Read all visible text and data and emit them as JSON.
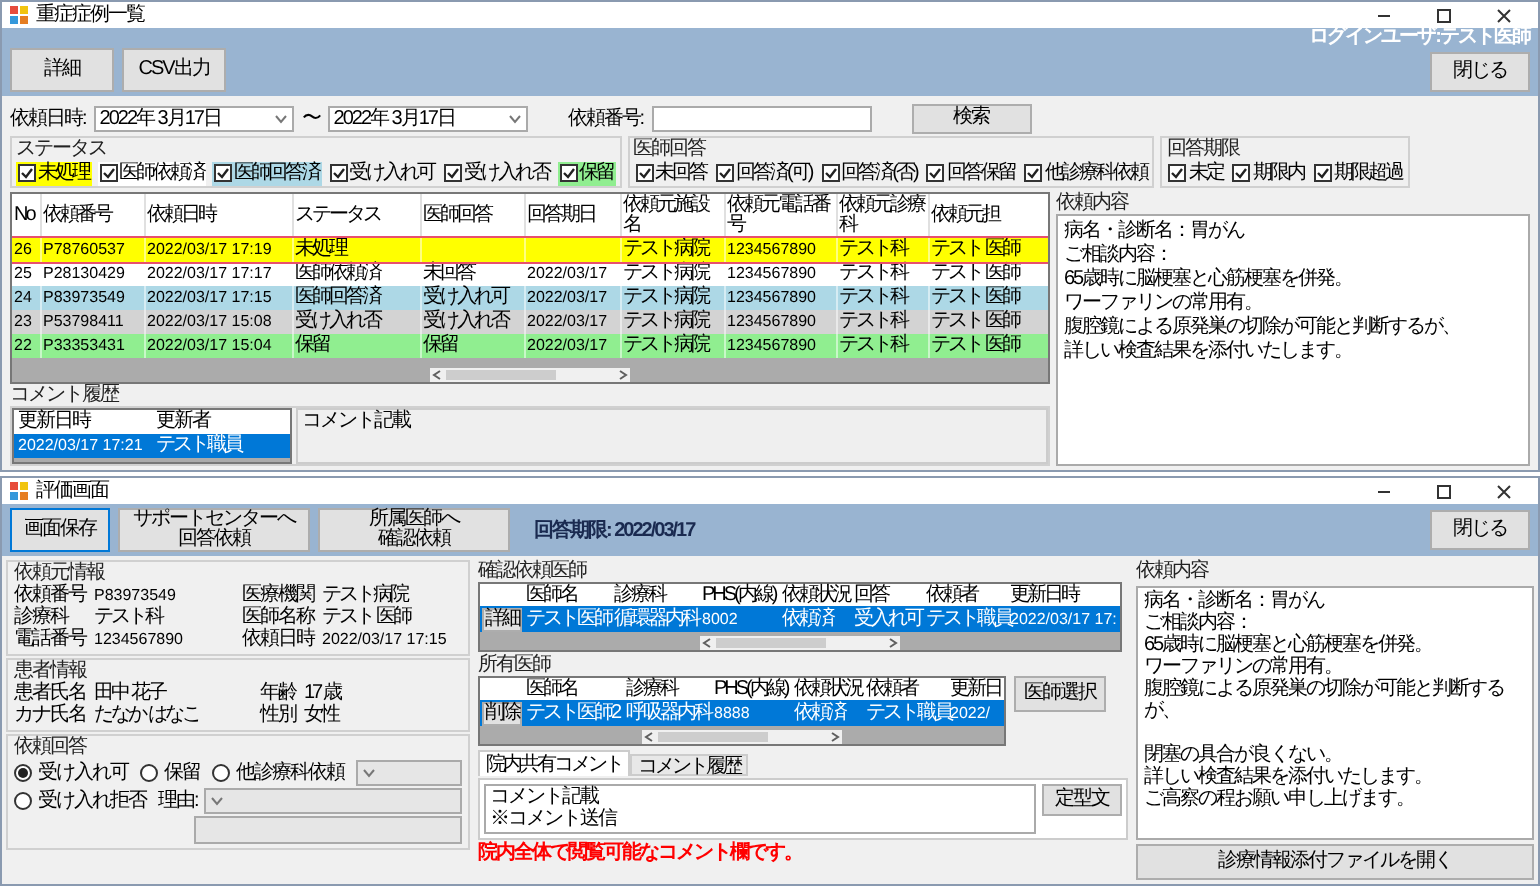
{
  "main_window": {
    "title": "重症症例一覧",
    "toolbar": {
      "buttons": [
        "詳細",
        "CSV出力"
      ],
      "login_user": "ログインユーザ:テスト医師",
      "close_button": "閉じる"
    },
    "filter": {
      "date_label": "依頼日時:",
      "date_from": "2022年 3月17日",
      "separator": "〜",
      "date_to": "2022年 3月17日",
      "number_label": "依頼番号:",
      "search_button": "検索"
    },
    "filter_groups": [
      {
        "title": "ステータス",
        "options": [
          {
            "label": "未処理",
            "checked": true,
            "color": "#ffff00"
          },
          {
            "label": "医師依頼済",
            "checked": true,
            "color": "#ffffff"
          },
          {
            "label": "医師回答済",
            "checked": true,
            "color": "#add8e6"
          },
          {
            "label": "受け入れ可",
            "checked": true
          },
          {
            "label": "受け入れ否",
            "checked": true
          },
          {
            "label": "保留",
            "checked": true,
            "color": "#90ee90"
          }
        ]
      },
      {
        "title": "医師回答",
        "options": [
          {
            "label": "未回答",
            "checked": true
          },
          {
            "label": "回答済(可)",
            "checked": true
          },
          {
            "label": "回答済(否)",
            "checked": true
          },
          {
            "label": "回答保留",
            "checked": true
          },
          {
            "label": "他診療科依頼",
            "checked": true
          }
        ]
      },
      {
        "title": "回答期限",
        "options": [
          {
            "label": "未定",
            "checked": true
          },
          {
            "label": "期限内",
            "checked": true
          },
          {
            "label": "期限超過",
            "checked": true
          }
        ]
      }
    ],
    "table": {
      "columns": [
        "No",
        "依頼番号",
        "依頼日時",
        "ステータス",
        "医師回答",
        "回答期日",
        "依頼元施設名",
        "依頼元電話番号",
        "依頼元診療科",
        "依頼元担"
      ],
      "rows": [
        {
          "cells": [
            "26",
            "P78760537",
            "2022/03/17 17:19",
            "未処理",
            null,
            null,
            "テスト病院",
            "1234567890",
            "テスト科",
            "テスト 医師"
          ],
          "color": "#ffff00",
          "selected": true
        },
        {
          "cells": [
            "25",
            "P28130429",
            "2022/03/17 17:17",
            "医師依頼済",
            "未回答",
            "2022/03/17",
            "テスト病院",
            "1234567890",
            "テスト科",
            "テスト 医師"
          ],
          "color": "#ffffff",
          "selected": false
        },
        {
          "cells": [
            "24",
            "P83973549",
            "2022/03/17 17:15",
            "医師回答済",
            "受け入れ可",
            "2022/03/17",
            "テスト病院",
            "1234567890",
            "テスト科",
            "テスト 医師"
          ],
          "color": "#add8e6",
          "selected": false
        },
        {
          "cells": [
            "23",
            "P53798411",
            "2022/03/17 15:08",
            "受け入れ否",
            "受け入れ否",
            "2022/03/17",
            "テスト病院",
            "1234567890",
            "テスト科",
            "テスト 医師"
          ],
          "color": "#d3d3d3",
          "selected": false
        },
        {
          "cells": [
            "22",
            "P33353431",
            "2022/03/17 15:04",
            "保留",
            "保留",
            "2022/03/17",
            "テスト病院",
            "1234567890",
            "テスト科",
            "テスト 医師"
          ],
          "color": "#90ee90",
          "selected": false
        }
      ]
    },
    "comment_history": {
      "title": "コメント履歴",
      "columns": [
        "更新日時",
        "更新者"
      ],
      "rows": [
        {
          "cells": [
            "2022/03/17 17:21",
            "テスト職員"
          ],
          "selected": true
        }
      ],
      "comment": "コメント記載"
    },
    "request_panel": {
      "title": "依頼内容",
      "lines": [
        "病名・診断名：胃がん",
        "ご相談内容：",
        "65歳時に脳梗塞と心筋梗塞を併発。",
        "ワーファリンの常用有。",
        "腹腔鏡による原発巣の切除が可能と判断するが、",
        "詳しい検査結果を添付いたします。"
      ]
    }
  },
  "detail_window": {
    "title": "評価画面",
    "toolbar": {
      "buttons": [
        [
          "画面保存"
        ],
        [
          "サポートセンターへ",
          "回答依頼"
        ],
        [
          "所属医師へ",
          "確認依頼"
        ]
      ],
      "deadline": "回答期限: 2022/03/17",
      "close_button": "閉じる"
    },
    "requester": {
      "title": "依頼元情報",
      "fields": [
        {
          "label": "依頼番号",
          "value": "P83973549"
        },
        {
          "label": "医療機関",
          "value": "テスト病院"
        },
        {
          "label": "診療科",
          "value": "テスト科"
        },
        {
          "label": "医師名称",
          "value": "テスト 医師"
        },
        {
          "label": "電話番号",
          "value": "1234567890"
        },
        {
          "label": "依頼日時",
          "value": "2022/03/17 17:15"
        }
      ]
    },
    "patient": {
      "title": "患者情報",
      "fields": [
        {
          "label": "患者氏名",
          "value": "田中 花子"
        },
        {
          "label": "年齢",
          "value": "17 歳"
        },
        {
          "label": "カナ氏名",
          "value": "たなか はなこ"
        },
        {
          "label": "性別",
          "value": "女性"
        }
      ]
    },
    "answer": {
      "title": "依頼回答",
      "options": [
        {
          "label": "受け入れ可",
          "selected": true
        },
        {
          "label": "保留",
          "selected": false
        },
        {
          "label": "他診療科依頼",
          "selected": false
        },
        {
          "label": "受け入れ拒否",
          "selected": false
        }
      ],
      "reason_label": "理由:"
    },
    "confirm_doctors": {
      "title": "確認依頼医師",
      "columns": [
        "医師名",
        "診療科",
        "PHS(内線)",
        "依頼状況",
        "回答",
        "依頼者",
        "更新日時"
      ],
      "rows": [
        {
          "button": "詳細",
          "cells": [
            "テスト医師",
            "循環器内科",
            "8002",
            "依頼済",
            "受入れ可",
            "テスト職員",
            "2022/03/17 17:"
          ],
          "selected": true
        }
      ]
    },
    "shared_doctors": {
      "title": "所有医師",
      "columns": [
        "医師名",
        "診療科",
        "PHS(内線)",
        "依頼状況",
        "依頼者",
        "更新日"
      ],
      "rows": [
        {
          "button": "削除",
          "cells": [
            "テスト医師2",
            "呼吸器内科",
            "8888",
            "依頼済",
            "テスト職員",
            "2022/"
          ],
          "selected": true
        }
      ],
      "select_button": "医師選択"
    },
    "request_content": {
      "title": "依頼内容",
      "paragraphs": [
        [
          "病名・診断名：胃がん",
          "ご相談内容：",
          "65歳時に脳梗塞と心筋梗塞を併発。",
          "ワーファリンの常用有。",
          "腹腔鏡による原発巣の切除が可能と判断するが、"
        ],
        [
          "閉塞の具合が良くない。",
          "詳しい検査結果を添付いたします。",
          "ご高察の程お願い申し上げます。"
        ]
      ]
    },
    "attachment_button": "診療情報添付ファイルを開く",
    "comments": {
      "tabs": [
        {
          "label": "院内共有コメント",
          "selected": true
        },
        {
          "label": "コメント履歴",
          "selected": false
        }
      ],
      "lines": [
        "コメント記載",
        "※コメント送信"
      ],
      "template_button": "定型文",
      "note": "院内全体で閲覧可能なコメント欄です。"
    }
  }
}
